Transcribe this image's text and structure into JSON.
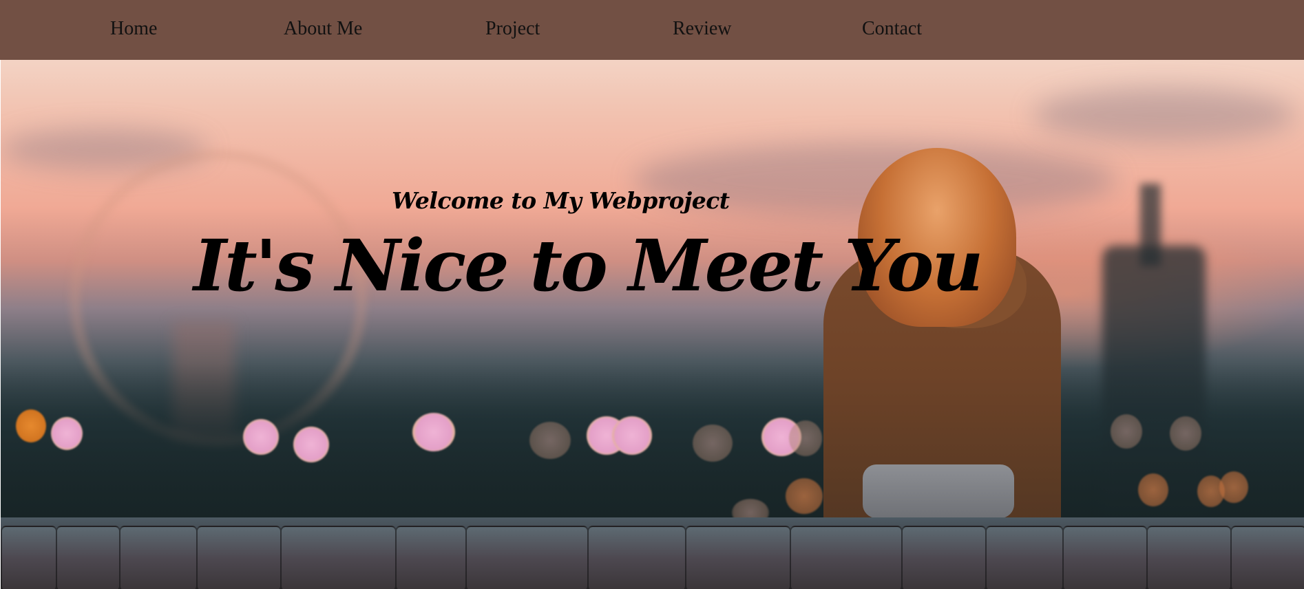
{
  "nav": {
    "items": [
      {
        "label": "Home"
      },
      {
        "label": "About Me"
      },
      {
        "label": "Project"
      },
      {
        "label": "Review"
      },
      {
        "label": "Contact"
      }
    ],
    "background": "#725044"
  },
  "hero": {
    "subtitle": "Welcome to My Webproject",
    "headline": "It's Nice to Meet You",
    "text_color": "#000000"
  }
}
